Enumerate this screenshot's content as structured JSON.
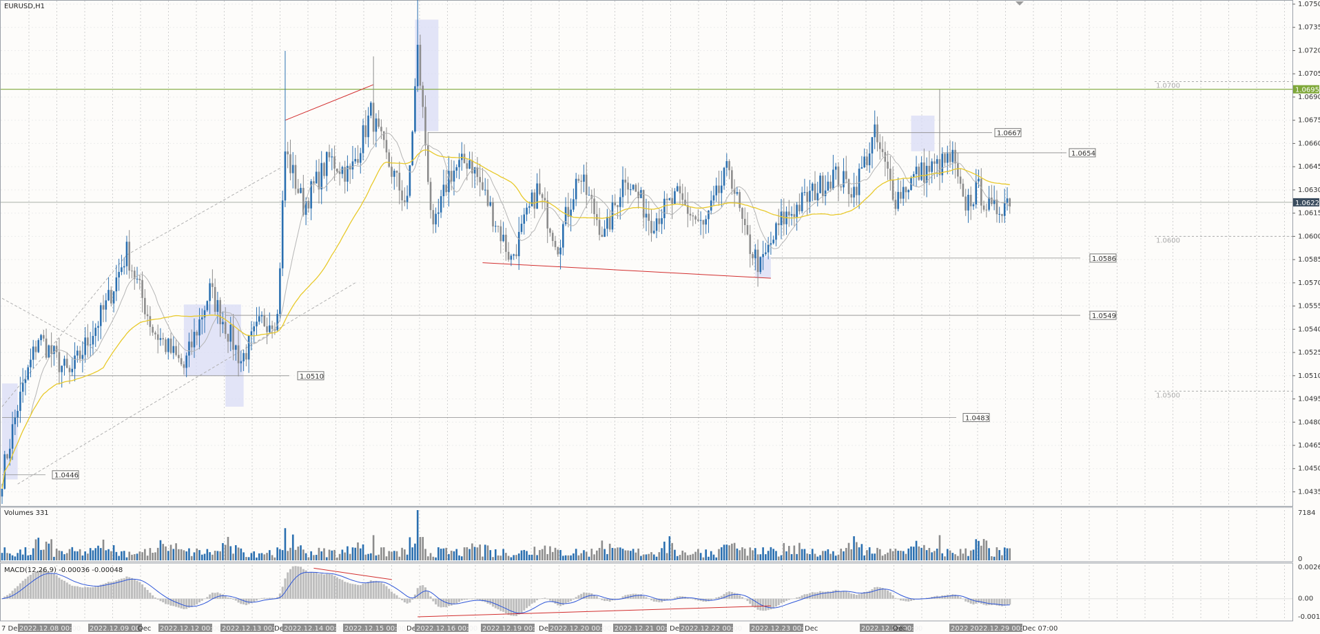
{
  "symbol": "EURUSD,H1",
  "volume_label": "Volumes 331",
  "macd_label": "MACD(12,26,9) -0.00036 -0.00048",
  "colors": {
    "bull": "#2a6fb0",
    "bear": "#8c8c8c",
    "ma_fast": "#b5b5b5",
    "ma_slow": "#e8c92a",
    "trend_red": "#d22d2d",
    "zone": "#d8dcf6",
    "resistance": "#7fa83a",
    "macd_signal": "#2d55d8",
    "macd_hist": "#bdbdbd"
  },
  "chart_data": [
    {
      "type": "line",
      "name": "price",
      "ylim": [
        1.043,
        1.075
      ],
      "y_ticks": [
        "1.0750",
        "1.0735",
        "1.0720",
        "1.0705",
        "1.0690",
        "1.0675",
        "1.0660",
        "1.0645",
        "1.0630",
        "1.0615",
        "1.0600",
        "1.0585",
        "1.0570",
        "1.0555",
        "1.0540",
        "1.0525",
        "1.0510",
        "1.0495",
        "1.0480",
        "1.0465",
        "1.0450",
        "1.0435"
      ],
      "current_price": "1.0622",
      "resistance_label": "1.0695",
      "round_levels": [
        "1.0700",
        "1.0600",
        "1.0500"
      ],
      "levels": [
        "1.0667",
        "1.0654",
        "1.0586",
        "1.0549",
        "1.0510",
        "1.0483",
        "1.0446"
      ],
      "x_labels": [
        "7 Dec",
        "2022.12.08 00:00",
        "2022.12.09 00:00",
        "Dec",
        "2022.12.12 00:00",
        "2022.12.13 00:00",
        "Dec",
        "2022.12.14 00:00",
        "2022.12.15 00:00",
        "Dec",
        "2022.12.16 00:00",
        "2022.12.19 00:00",
        "Dec",
        "2022.12.20 00:00",
        "2022.12.21 00:00",
        "Dec",
        "2022.12.22 00:00",
        "2022.12.23 00:00",
        "Dec",
        "2022.12.27 00:00",
        "Dec",
        "2022.12.28 00:00",
        "2022.12.29 00:00",
        "Dec 07:00"
      ],
      "anchors": [
        [
          0,
          1.0445
        ],
        [
          6,
          1.049
        ],
        [
          14,
          1.0535
        ],
        [
          26,
          1.051
        ],
        [
          40,
          1.0555
        ],
        [
          48,
          1.059
        ],
        [
          58,
          1.054
        ],
        [
          70,
          1.0515
        ],
        [
          80,
          1.0565
        ],
        [
          92,
          1.052
        ],
        [
          100,
          1.0545
        ],
        [
          106,
          1.0548
        ],
        [
          109,
          1.0655
        ],
        [
          116,
          1.062
        ],
        [
          126,
          1.065
        ],
        [
          134,
          1.064
        ],
        [
          142,
          1.068
        ],
        [
          148,
          1.065
        ],
        [
          156,
          1.062
        ],
        [
          160,
          1.072
        ],
        [
          166,
          1.06
        ],
        [
          172,
          1.064
        ],
        [
          180,
          1.065
        ],
        [
          190,
          1.061
        ],
        [
          196,
          1.0585
        ],
        [
          206,
          1.063
        ],
        [
          214,
          1.0595
        ],
        [
          222,
          1.064
        ],
        [
          232,
          1.06
        ],
        [
          240,
          1.064
        ],
        [
          250,
          1.061
        ],
        [
          260,
          1.0625
        ],
        [
          270,
          1.0605
        ],
        [
          280,
          1.0645
        ],
        [
          286,
          1.06
        ],
        [
          292,
          1.058
        ],
        [
          300,
          1.061
        ],
        [
          310,
          1.0625
        ],
        [
          320,
          1.064
        ],
        [
          328,
          1.063
        ],
        [
          336,
          1.0665
        ],
        [
          344,
          1.0625
        ],
        [
          352,
          1.064
        ],
        [
          360,
          1.0645
        ],
        [
          366,
          1.065
        ],
        [
          370,
          1.062
        ],
        [
          376,
          1.063
        ],
        [
          381,
          1.0615
        ],
        [
          388,
          1.0625
        ]
      ]
    },
    {
      "type": "bar",
      "name": "volume",
      "ylim": [
        0,
        7184
      ],
      "y_ticks": [
        "7184",
        "0"
      ]
    },
    {
      "type": "bar",
      "name": "macd",
      "ylim": [
        -0.00151,
        0.00263
      ],
      "y_ticks": [
        "0.00263",
        "0.00",
        "-0.00151"
      ]
    }
  ]
}
